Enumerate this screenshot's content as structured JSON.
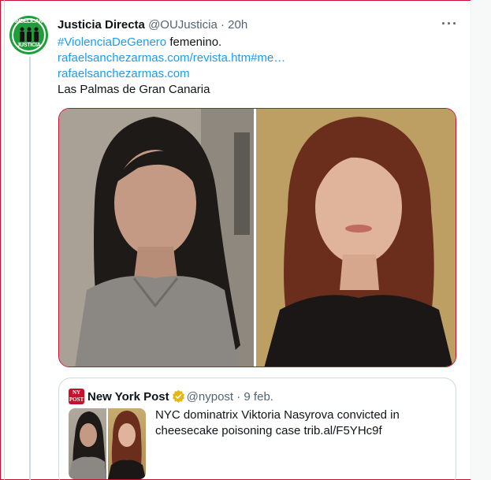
{
  "author": {
    "avatar_text_top": "INDELICAN",
    "avatar_text_bottom": "JUSTICIA",
    "name": "Justicia Directa",
    "handle": "@OUJusticia",
    "separator": "·",
    "time": "20h"
  },
  "tweet": {
    "hashtag": "#ViolenciaDeGenero",
    "line1_rest": " femenino.",
    "link1": "rafaelsanchezarmas.com/revista.htm#me…",
    "link2": "rafaelsanchezarmas.com",
    "location": "Las Palmas de Gran Canaria"
  },
  "more_menu": "···",
  "quoted": {
    "logo_text": "NY POST",
    "name": "New York Post",
    "handle": "@nypost",
    "separator": "·",
    "date": "9 feb.",
    "text": "NYC dominatrix Viktoria Nasyrova convicted in cheesecake poisoning case trib.al/F5YHc9f"
  },
  "colors": {
    "link": "#1d9bf0",
    "secondary_text": "#536471",
    "border": "#cfd9de",
    "verified_badge": "#e2b719",
    "avatar_bg": "#1f9d3a",
    "nypost_red": "#c8102e"
  },
  "icons": {
    "more": "more-icon",
    "verified": "verified-badge-icon"
  }
}
